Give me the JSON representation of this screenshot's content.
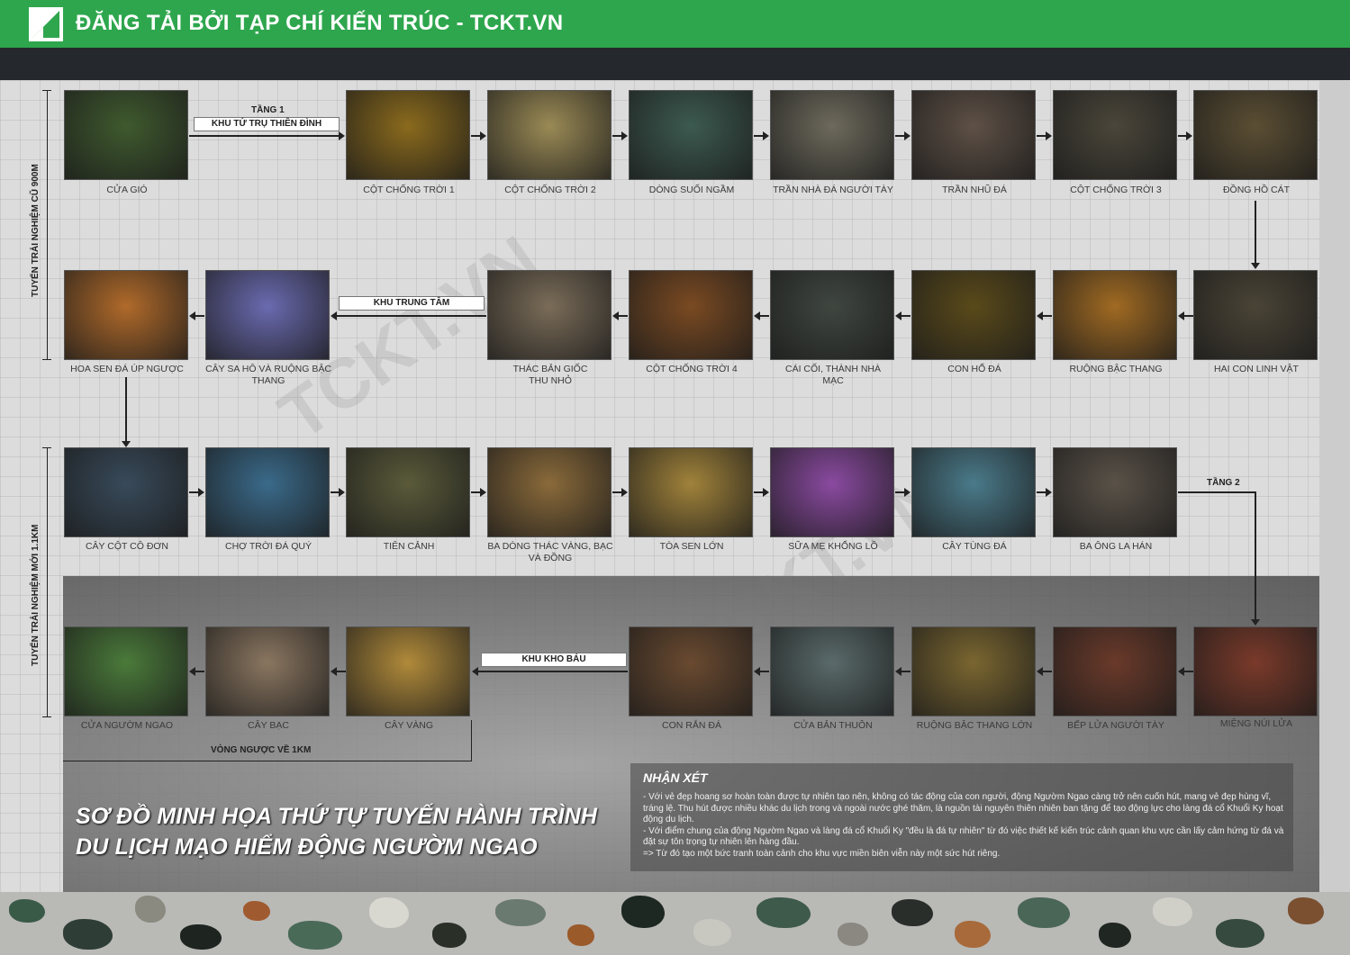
{
  "header": {
    "title": "ĐĂNG TẢI BỞI TẠP CHÍ KIẾN TRÚC - TCKT.VN",
    "bg": "#2ea64d"
  },
  "watermark": "TCKT.VN",
  "routes": {
    "old": "TUYẾN TRẢI NGHIỆM CŨ 900M",
    "new": "TUYẾN TRẢI NGHIỆM MỚI 1.1KM"
  },
  "zones": {
    "tier1": "TẦNG 1",
    "khu_tu_tru": "KHU TỨ TRỤ THIÊN ĐÌNH",
    "khu_trung_tam": "KHU TRUNG TÂM",
    "tier2": "TẦNG 2",
    "khu_kho_bau": "KHU KHO BÁU",
    "loop": "VÒNG NGƯỢC VỀ 1KM"
  },
  "stops": {
    "row1": [
      {
        "label": "CỬA GIÓ",
        "color": "#3f5a2e"
      },
      {
        "label": "CỘT CHỐNG TRỜI 1",
        "color": "#8a6a1c"
      },
      {
        "label": "CỘT CHỐNG TRỜI 2",
        "color": "#9a8a55"
      },
      {
        "label": "DÒNG SUỐI NGẦM",
        "color": "#3c5a50"
      },
      {
        "label": "TRẦN NHÀ ĐÁ NGƯỜI TÀY",
        "color": "#6d6a5c"
      },
      {
        "label": "TRẦN NHŨ ĐÁ",
        "color": "#5e5046"
      },
      {
        "label": "CỘT CHỐNG TRỜI 3",
        "color": "#4a463a"
      },
      {
        "label": "ĐỒNG HỒ CÁT",
        "color": "#5b4e33"
      }
    ],
    "row2": [
      {
        "label": "HOA SEN ĐÁ ÚP NGƯỢC",
        "color": "#b06a2a"
      },
      {
        "label": "CÂY SA HÔ VÀ RUỘNG BẬC THANG",
        "color": "#6a6ab0"
      },
      {
        "label": "THÁC BẢN GIỐC THU NHỎ",
        "color": "#7a6c58"
      },
      {
        "label": "CỘT CHỐNG TRỜI 4",
        "color": "#7a4a22"
      },
      {
        "label": "CÁI CỐI, THÀNH NHÀ MẠC",
        "color": "#3f4640"
      },
      {
        "label": "CON HỔ ĐÁ",
        "color": "#5a4a1a"
      },
      {
        "label": "RUỘNG BẬC THANG",
        "color": "#a06a22"
      },
      {
        "label": "HAI CON LINH VẬT",
        "color": "#4a4436"
      }
    ],
    "row3": [
      {
        "label": "CÂY CỘT CÔ ĐƠN",
        "color": "#384a5a"
      },
      {
        "label": "CHỢ TRỜI ĐÁ QUÝ",
        "color": "#3a6a8a"
      },
      {
        "label": "TIÊN CẢNH",
        "color": "#5a5a3a"
      },
      {
        "label": "BA DÒNG THÁC VÀNG, BẠC VÀ ĐỒNG",
        "color": "#8a6a3a"
      },
      {
        "label": "TÒA SEN LỚN",
        "color": "#a0823a"
      },
      {
        "label": "SỮA MẸ KHỔNG LỒ",
        "color": "#8a4aa0"
      },
      {
        "label": "CÂY TÙNG ĐÁ",
        "color": "#4a7a8a"
      },
      {
        "label": "BA ÔNG LA HÁN",
        "color": "#5a5248"
      }
    ],
    "row4": [
      {
        "label": "CỬA NGƯỜM NGAO",
        "color": "#4a7a3a"
      },
      {
        "label": "CÂY BẠC",
        "color": "#8a7660"
      },
      {
        "label": "CÂY VÀNG",
        "color": "#b08a3a"
      },
      {
        "label": "CON RẮN ĐÁ",
        "color": "#6a4a30"
      },
      {
        "label": "CỬA BẢN THUÔN",
        "color": "#5a6a6a"
      },
      {
        "label": "RUỘNG BẬC THANG LỚN",
        "color": "#7a6630"
      },
      {
        "label": "BẾP LỬA NGƯỜI TÀY",
        "color": "#6a3a2a"
      },
      {
        "label": "MIỆNG NÚI LỬA",
        "color": "#7a3a2a"
      }
    ]
  },
  "title": {
    "line1": "SƠ ĐỒ MINH HỌA THỨ TỰ TUYẾN HÀNH TRÌNH",
    "line2": "DU LỊCH MẠO HIỂM ĐỘNG NGƯỜM NGAO"
  },
  "notes": {
    "heading": "NHẬN XÉT",
    "p1": "- Với vẻ đẹp hoang sơ hoàn toàn được tự nhiên tạo nên, không có tác động của con người, động Ngườm Ngao càng trở nên cuốn hút, mang vẻ đẹp hùng vĩ, tráng lệ. Thu hút được nhiều khác du lịch trong và ngoài nước ghé thăm, là nguồn tài nguyên thiên nhiên ban tặng để tạo động lực cho làng đá cổ Khuổi Ky hoạt động du lịch.",
    "p2": "- Với điểm chung của động Ngườm Ngao và làng đá cổ Khuổi Ky \"đều là đá tự nhiên\" từ đó việc thiết kế kiến trúc cảnh quan khu vực cần lấy cảm hứng từ đá và đặt sự tôn trọng tự nhiên lên hàng đầu.",
    "p3": "=> Từ đó tạo một bức tranh toàn cảnh cho khu vực miền biên viễn này một sức hút riêng."
  }
}
